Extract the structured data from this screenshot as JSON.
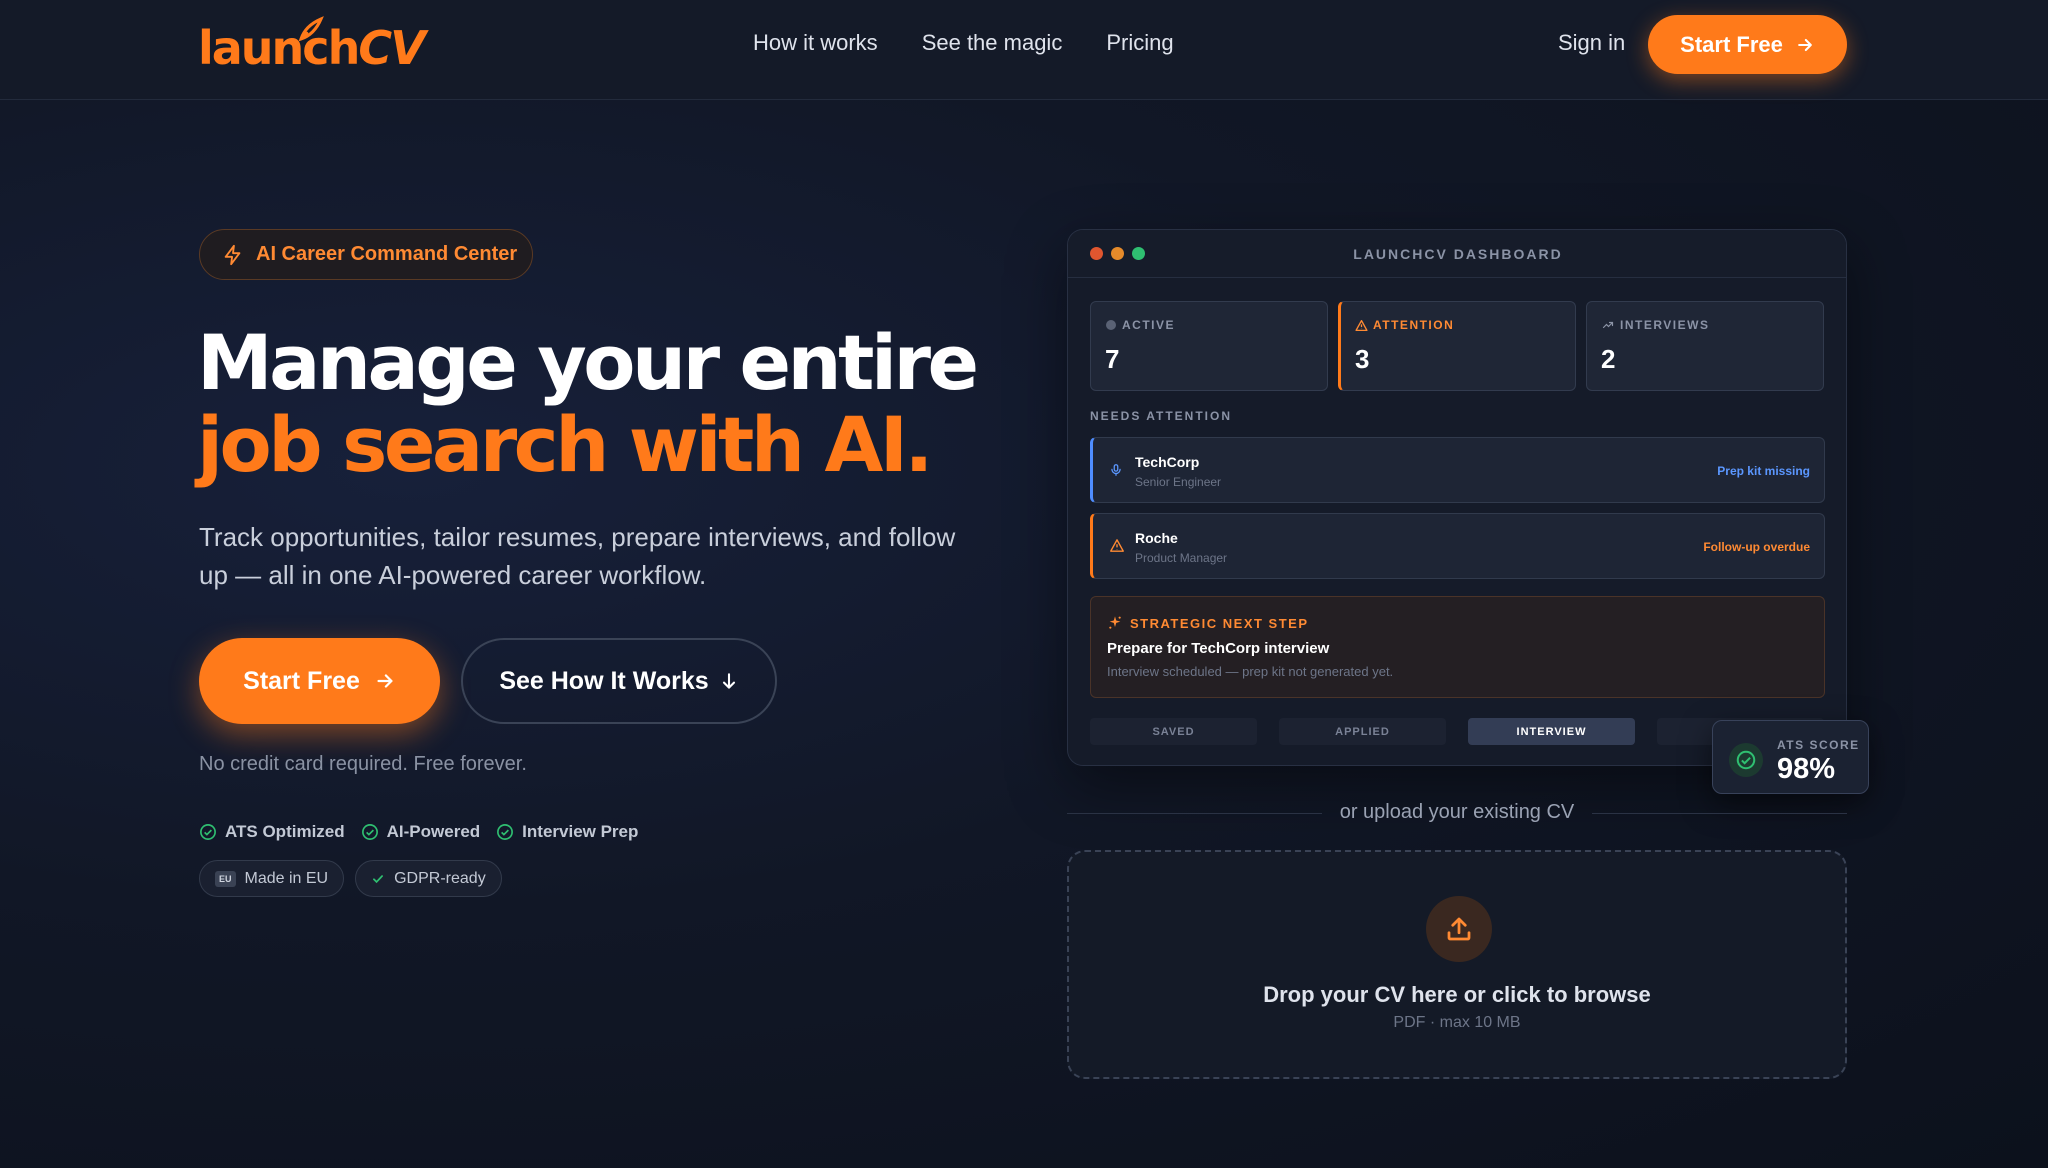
{
  "nav": {
    "logo_a": "launch",
    "logo_b": "CV",
    "links": [
      "How it works",
      "See the magic",
      "Pricing"
    ],
    "signin": "Sign in",
    "cta": "Start Free"
  },
  "hero": {
    "badge": "AI Career Command Center",
    "title_line1": "Manage your entire",
    "title_line2": "job search with AI.",
    "subtitle": "Track opportunities, tailor resumes, prepare interviews, and follow up — all in one AI-powered career workflow.",
    "primary_cta": "Start Free",
    "secondary_cta": "See How It Works",
    "note": "No credit card required. Free forever.",
    "checks": [
      "ATS Optimized",
      "AI-Powered",
      "Interview Prep"
    ],
    "pills": [
      {
        "icon": "eu-icon",
        "tag": "EU",
        "label": "Made in EU"
      },
      {
        "icon": "check-icon",
        "label": "GDPR-ready"
      }
    ]
  },
  "dashboard": {
    "title": "LAUNCHCV DASHBOARD",
    "dot_colors": [
      "#e0562f",
      "#e58a2a",
      "#2fbf71"
    ],
    "stats": [
      {
        "label": "ACTIVE",
        "value": "7"
      },
      {
        "label": "ATTENTION",
        "value": "3"
      },
      {
        "label": "INTERVIEWS",
        "value": "2"
      }
    ],
    "section_label": "NEEDS ATTENTION",
    "tasks": [
      {
        "company": "TechCorp",
        "role": "Senior Engineer",
        "status": "Prep kit missing",
        "icon": "microphone-icon"
      },
      {
        "company": "Roche",
        "role": "Product Manager",
        "status": "Follow-up overdue",
        "icon": "warning-icon"
      }
    ],
    "next_step": {
      "label": "STRATEGIC NEXT STEP",
      "title": "Prepare for TechCorp interview",
      "desc": "Interview scheduled — prep kit not generated yet."
    },
    "pipeline": [
      "SAVED",
      "APPLIED",
      "INTERVIEW",
      ""
    ],
    "pipeline_active": "INTERVIEW"
  },
  "ats": {
    "label": "ATS SCORE",
    "value": "98%"
  },
  "upload": {
    "or_text": "or upload your existing CV",
    "title": "Drop your CV here or click to browse",
    "subtitle": "PDF · max 10 MB"
  },
  "colors": {
    "accent": "#ff7a1a",
    "blue": "#4f8dff",
    "green": "#2fbf71"
  }
}
